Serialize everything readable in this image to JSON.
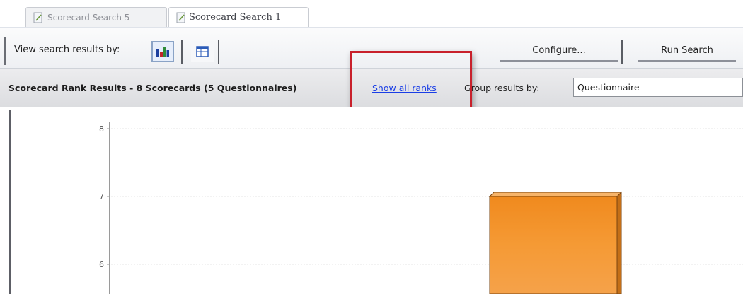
{
  "tabs": [
    {
      "label": "Scorecard Search 5",
      "active": false
    },
    {
      "label": "Scorecard Search 1",
      "active": true
    }
  ],
  "toolbar": {
    "view_label": "View search results by:",
    "view_buttons": [
      {
        "icon": "bar-chart-icon",
        "selected": true
      },
      {
        "icon": "grid-table-icon",
        "selected": false
      }
    ],
    "configure_label": "Configure...",
    "run_label": "Run Search"
  },
  "results": {
    "title": "Scorecard Rank Results - 8 Scorecards  (5 Questionnaires)",
    "show_all_ranks": "Show all ranks",
    "group_label": "Group results by:",
    "group_value": "Questionnaire"
  },
  "colors": {
    "bar": "#f59a35",
    "link": "#1a3ee6",
    "highlight": "#c8202b"
  },
  "chart_data": {
    "type": "bar",
    "y_ticks": [
      6,
      7,
      8
    ],
    "ylim": [
      5.6,
      8.1
    ],
    "grid": true,
    "series": [
      {
        "values": [
          7
        ]
      }
    ]
  }
}
